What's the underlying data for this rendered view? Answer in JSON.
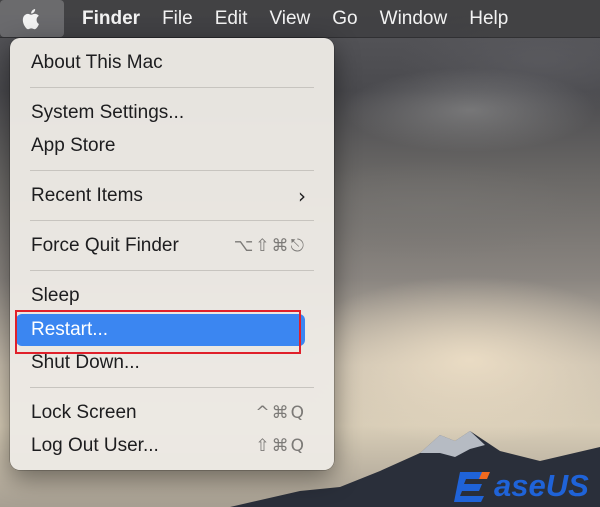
{
  "menubar": {
    "app_name": "Finder",
    "menus": [
      "File",
      "Edit",
      "View",
      "Go",
      "Window",
      "Help"
    ]
  },
  "apple_menu": {
    "items": [
      {
        "label": "About This Mac",
        "shortcut": ""
      },
      {
        "label": "System Settings...",
        "shortcut": ""
      },
      {
        "label": "App Store",
        "shortcut": ""
      },
      {
        "label": "Recent Items",
        "shortcut": "›"
      },
      {
        "label": "Force Quit Finder",
        "shortcut": "⌥⇧⌘⎋"
      },
      {
        "label": "Sleep",
        "shortcut": ""
      },
      {
        "label": "Restart...",
        "shortcut": ""
      },
      {
        "label": "Shut Down...",
        "shortcut": ""
      },
      {
        "label": "Lock Screen",
        "shortcut": "^⌘Q"
      },
      {
        "label": "Log Out User...",
        "shortcut": "⇧⌘Q"
      }
    ],
    "selected_item": "Restart..."
  },
  "watermark": {
    "text": "aseUS"
  },
  "colors": {
    "selection": "#3b86f1",
    "annotation_border": "#e0202a",
    "logo": "#1f63d8"
  }
}
